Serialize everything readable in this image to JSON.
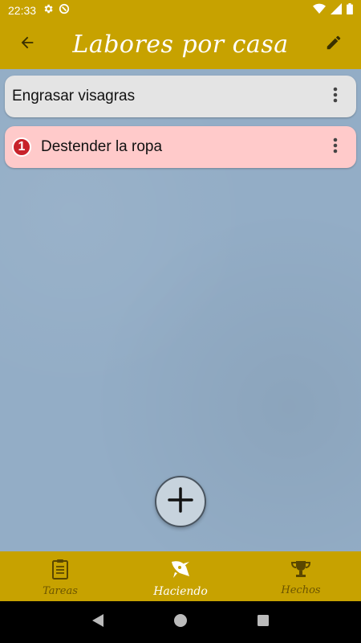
{
  "status_bar": {
    "time": "22:33",
    "left_icons": [
      "settings-gear-icon",
      "circle-status-icon"
    ],
    "right_icons": [
      "wifi-icon",
      "cellular-signal-icon",
      "battery-icon"
    ]
  },
  "app_bar": {
    "title": "Labores por casa",
    "back_icon": "back-arrow-icon",
    "edit_icon": "pencil-icon"
  },
  "tasks": [
    {
      "title": "Engrasar visagras",
      "priority": null,
      "background": "#e4e4e4"
    },
    {
      "title": "Destender la ropa",
      "priority": "1",
      "background": "#ffcaca"
    }
  ],
  "fab": {
    "icon": "plus-icon"
  },
  "bottom_nav": {
    "items": [
      {
        "label": "Tareas",
        "icon": "clipboard-icon",
        "active": false
      },
      {
        "label": "Haciendo",
        "icon": "rocket-icon",
        "active": true
      },
      {
        "label": "Hechos",
        "icon": "trophy-icon",
        "active": false
      }
    ]
  },
  "colors": {
    "accent": "#c7a200",
    "background": "#93adc6",
    "priority_badge": "#c8232b"
  }
}
